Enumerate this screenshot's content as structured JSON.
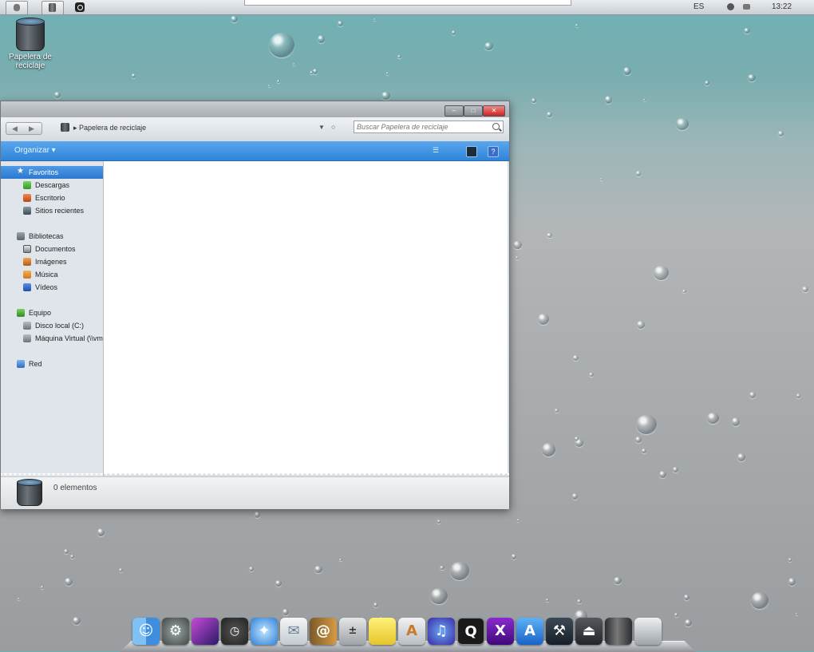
{
  "topbar": {
    "language": "ES",
    "clock": "13:22",
    "left_icons": [
      "apple-menu-icon",
      "trash-icon",
      "quicktime-icon"
    ],
    "right_icons": [
      "volume-icon",
      "network-icon"
    ]
  },
  "desktop": {
    "icons": [
      {
        "label": "Papelera de reciclaje",
        "icon": "trash-icon"
      }
    ]
  },
  "window": {
    "title": "",
    "breadcrumb": "Papelera de reciclaje",
    "search_placeholder": "Buscar Papelera de reciclaje",
    "command_bar": {
      "organize": "Organizar"
    },
    "sidebar": {
      "favorites": {
        "label": "Favoritos",
        "items": [
          "Descargas",
          "Escritorio",
          "Sitios recientes"
        ]
      },
      "libraries": {
        "label": "Bibliotecas",
        "items": [
          "Documentos",
          "Imágenes",
          "Música",
          "Vídeos"
        ]
      },
      "computer": {
        "label": "Equipo",
        "items": [
          "Disco local (C:)",
          "Máquina Virtual (\\\\vmware"
        ]
      },
      "network": {
        "label": "Red"
      }
    },
    "details": {
      "count": "0 elementos"
    }
  },
  "dock": {
    "items": [
      "finder-icon",
      "system-preferences-icon",
      "photo-booth-icon",
      "dashboard-icon",
      "safari-icon",
      "mail-icon",
      "address-book-icon",
      "calculator-icon",
      "stickies-icon",
      "textedit-icon",
      "itunes-icon",
      "quicktime-icon",
      "x11-icon",
      "app-store-icon",
      "xcode-icon",
      "eject-icon",
      "trash-icon",
      "expose-icon"
    ]
  },
  "colors": {
    "command_bar": "#3a8fe0",
    "selected_sidebar": "#3a87d8",
    "close_button": "#d33333"
  }
}
